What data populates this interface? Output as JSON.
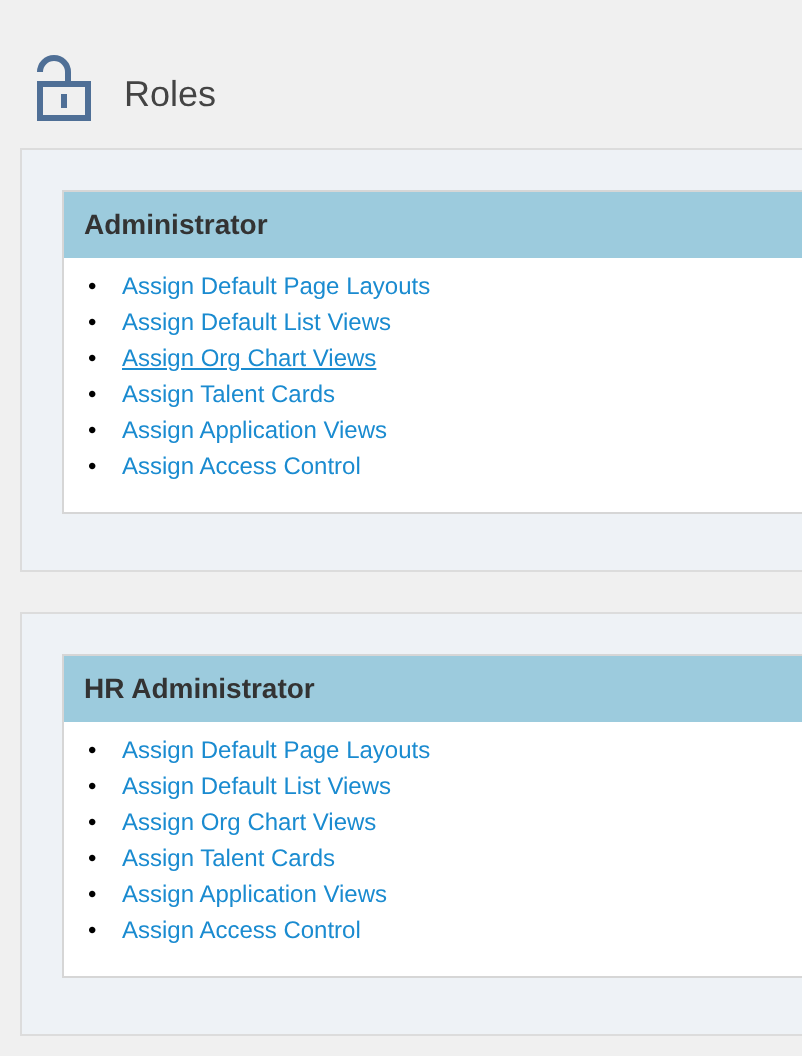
{
  "page": {
    "title": "Roles"
  },
  "roles": [
    {
      "name": "Administrator",
      "links": [
        {
          "bullet": "•",
          "label": "Assign Default Page Layouts",
          "hovered": false
        },
        {
          "bullet": "•",
          "label": "Assign Default List Views",
          "hovered": false
        },
        {
          "bullet": "•",
          "label": "Assign Org Chart Views",
          "hovered": true
        },
        {
          "bullet": "•",
          "label": "Assign Talent Cards",
          "hovered": false
        },
        {
          "bullet": "•",
          "label": "Assign Application Views",
          "hovered": false
        },
        {
          "bullet": "•",
          "label": "Assign Access Control",
          "hovered": false
        }
      ]
    },
    {
      "name": "HR Administrator",
      "links": [
        {
          "bullet": "•",
          "label": "Assign Default Page Layouts",
          "hovered": false
        },
        {
          "bullet": "•",
          "label": "Assign Default List Views",
          "hovered": false
        },
        {
          "bullet": "•",
          "label": "Assign Org Chart Views",
          "hovered": false
        },
        {
          "bullet": "•",
          "label": "Assign Talent Cards",
          "hovered": false
        },
        {
          "bullet": "•",
          "label": "Assign Application Views",
          "hovered": false
        },
        {
          "bullet": "•",
          "label": "Assign Access Control",
          "hovered": false
        }
      ]
    }
  ]
}
